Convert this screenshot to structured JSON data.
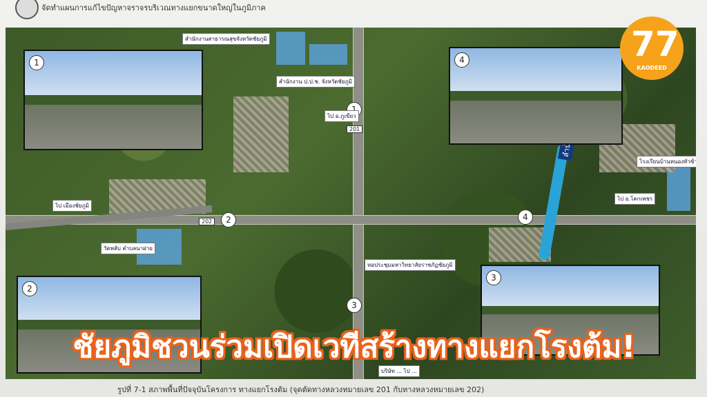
{
  "header": {
    "text": "จัดทำแผนการแก้ไขปัญหาจราจรบริเวณทางแยกขนาดใหญ่ในภูมิภาค"
  },
  "brand": {
    "mark": "77",
    "name": "KAODEED"
  },
  "photos": [
    {
      "number": "1"
    },
    {
      "number": "2"
    },
    {
      "number": "3"
    },
    {
      "number": "4"
    }
  ],
  "markers": [
    "1",
    "2",
    "3",
    "4"
  ],
  "road_shields": [
    "201",
    "202"
  ],
  "river_label": "ลำน้ำชีน้อย",
  "map_labels": [
    "สำนักงานสาธารณสุขจังหวัดชัยภูมิ",
    "สำนักงาน ป.ป.ช. จังหวัดชัยภูมิ",
    "ไป อ.ภูเขียว",
    "ไป เมืองชัยภูมิ",
    "วัดพลับ ตำบลนาฝาย",
    "ไป อ.โคกเพชร",
    "โรงเรียนบ้านหนองหัวช้าง",
    "หอประชุมมหาวิทยาลัยราชภัฏชัยภูมิ",
    "บริษัท ... ไป ..."
  ],
  "overlay_title": "ชัยภูมิชวนร่วมเปิดเวทีสร้างทางแยกโรงต้ม!",
  "caption": "รูปที่ 7-1 สภาพพื้นที่ปัจจุบันโครงการ ทางแยกโรงต้ม (จุดตัดทางหลวงหมายเลข 201 กับทางหลวงหมายเลข 202)",
  "colors": {
    "overlay_title_outline": "#e8631c",
    "brand_circle": "#f7a21b",
    "river": "#2aa4d6"
  }
}
